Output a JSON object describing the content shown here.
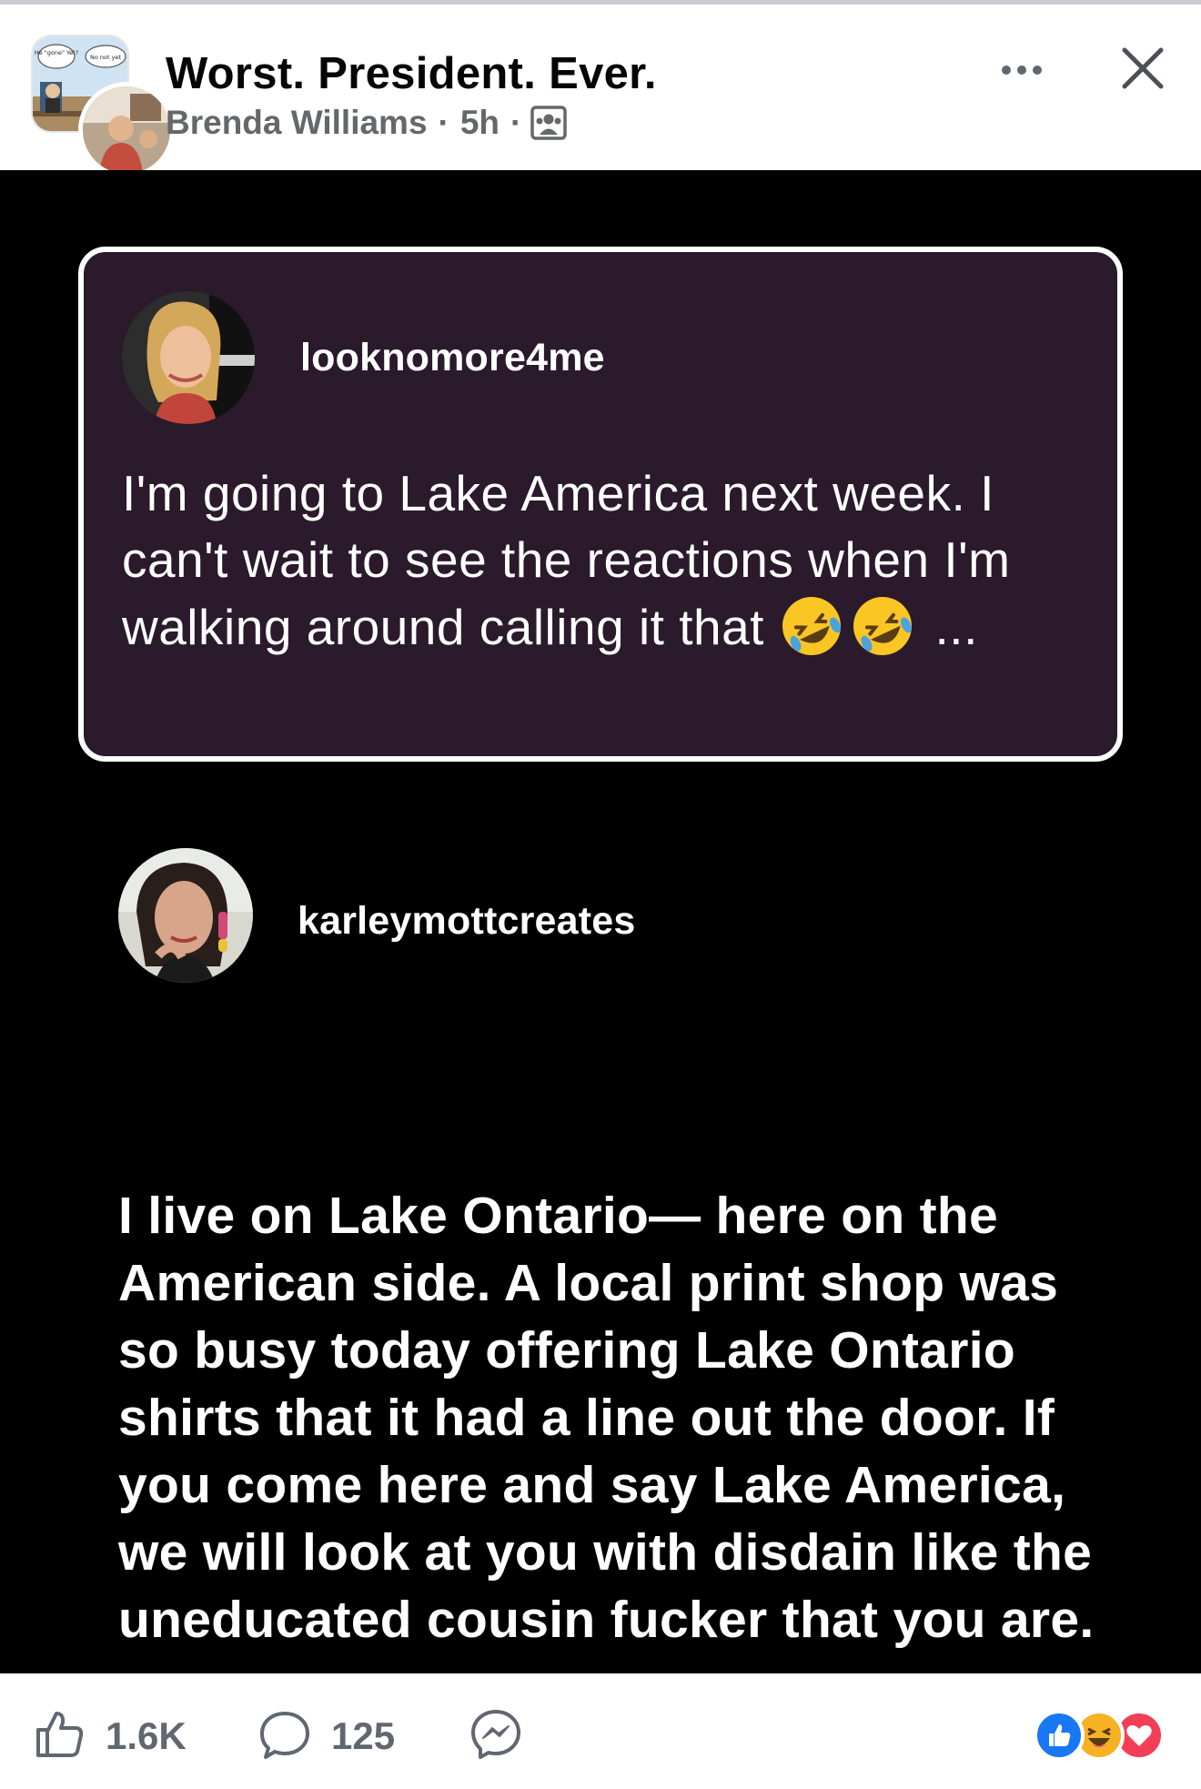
{
  "header": {
    "group_name": "Worst. President. Ever.",
    "author": "Brenda Williams",
    "time": "5h",
    "separator": "·",
    "group_avatar_captions": [
      "He \"gone\" Yet?",
      "No not yet"
    ]
  },
  "post": {
    "first_comment": {
      "username": "looknomore4me",
      "text": "I'm going to Lake America next week. I can't wait to see the reactions when I'm walking around calling it that",
      "emoji": "rolling-on-floor-laughing-emoji",
      "trailing": " ..."
    },
    "reply": {
      "username": "karleymottcreates",
      "text": "I live on Lake Ontario— here on the American side. A local print shop was so busy today offering Lake Ontario shirts that it had a line out the door. If you come here and say Lake America, we will look at you with disdain like the uneducated cousin fucker that you are."
    }
  },
  "footer": {
    "likes": "1.6K",
    "comments": "125",
    "icons": [
      "thumbs-up-icon",
      "comment-icon",
      "messenger-icon"
    ],
    "reactions": [
      "like-reaction",
      "haha-reaction",
      "love-reaction"
    ]
  },
  "colors": {
    "card_bg": "#2a1a2c",
    "image_bg": "#000000",
    "meta_gray": "#65676b",
    "like_blue": "#1877f2",
    "love_red": "#f33e58",
    "haha_yellow": "#f7b125"
  }
}
